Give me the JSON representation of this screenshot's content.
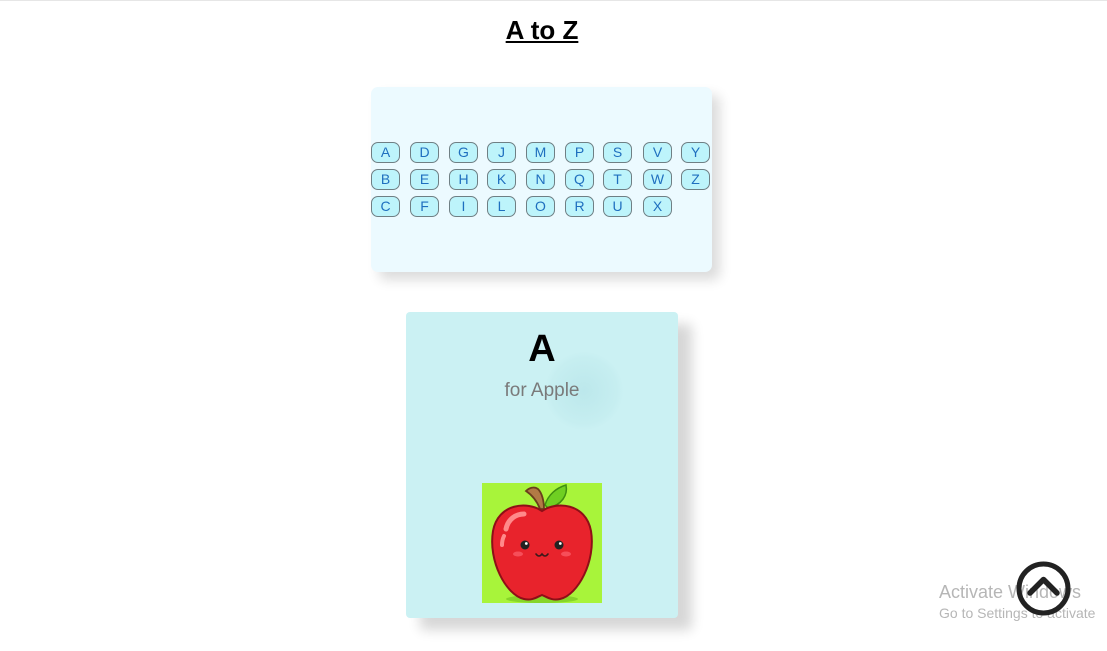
{
  "page": {
    "title": "A to Z"
  },
  "letters": {
    "columns": [
      [
        "A",
        "B",
        "C"
      ],
      [
        "D",
        "E",
        "F"
      ],
      [
        "G",
        "H",
        "I"
      ],
      [
        "J",
        "K",
        "L"
      ],
      [
        "M",
        "N",
        "O"
      ],
      [
        "P",
        "Q",
        "R"
      ],
      [
        "S",
        "T",
        "U"
      ],
      [
        "V",
        "W",
        "X"
      ],
      [
        "Y",
        "Z"
      ]
    ]
  },
  "card": {
    "letter": "A",
    "word": "for Apple",
    "image_icon": "apple-icon"
  },
  "watermark": {
    "title": "Activate Windows",
    "subtitle": "Go to Settings to activate"
  },
  "scroll_top": {
    "icon": "chevron-up-icon"
  },
  "colors": {
    "panel_bg": "#ecfaff",
    "button_bg": "#bdf4fb",
    "button_text": "#1f6fbf",
    "card_bg": "#cbf1f3",
    "image_bg": "#a8f43a",
    "apple_red": "#e8232c"
  }
}
